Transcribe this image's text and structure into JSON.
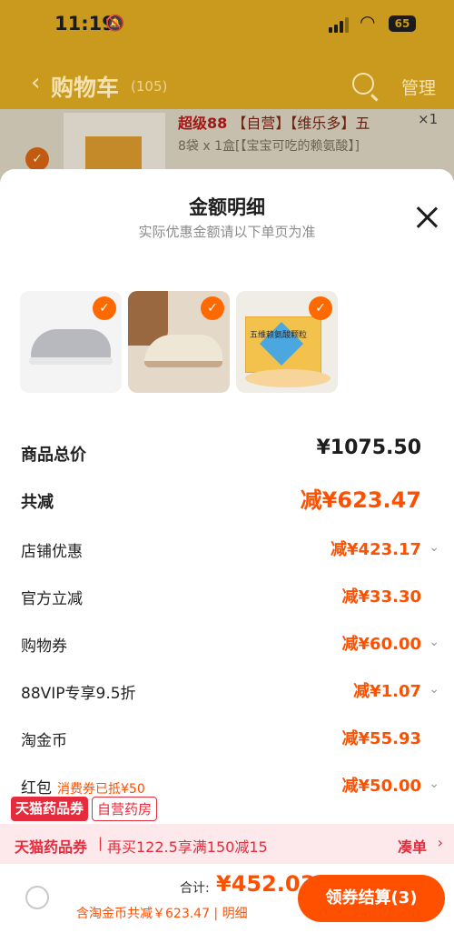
{
  "status_bar": {
    "time": "11:19",
    "battery": "65"
  },
  "header": {
    "title": "购物车",
    "count": "(105)",
    "manage": "管理"
  },
  "background_item": {
    "title_prefix": "超级88",
    "title_rest": "【自营】【维乐多】五",
    "subtitle": "8袋 x 1盒[【宝宝可吃的赖氨酸】]",
    "quantity": "×1",
    "thumb_label": "五维赖氨酸颗粒"
  },
  "sheet": {
    "title": "金额明细",
    "subtitle": "实际优惠金额请以下单页为准",
    "box_label": "五维赖氨酸颗粒",
    "rows": [
      {
        "label": "商品总价",
        "value": "¥1075.50"
      },
      {
        "label": "共减",
        "value": "减¥623.47"
      },
      {
        "label": "店铺优惠",
        "value": "减¥423.17"
      },
      {
        "label": "官方立减",
        "value": "减¥33.30"
      },
      {
        "label": "购物券",
        "value": "减¥60.00"
      },
      {
        "label": "88VIP专享9.5折",
        "value": "减¥1.07"
      },
      {
        "label": "淘金币",
        "value": "减¥55.93"
      },
      {
        "label": "红包",
        "extra": "消费券已抵¥50",
        "value": "减¥50.00"
      }
    ]
  },
  "tags": {
    "tag1": "天猫药品券",
    "tag2": "自营药房"
  },
  "promo": {
    "name": "天猫药品券",
    "desc": "再买122.5享满150减15",
    "action": "凑单"
  },
  "footer": {
    "total_label": "合计:",
    "total_value": "¥452.03",
    "detail": "含淘金币共减￥623.47 | 明细",
    "checkout": "领券结算(3)"
  },
  "colors": {
    "accent": "#ff5000",
    "tmall_red": "#e62b3c",
    "header_bg": "#c99a1e"
  }
}
